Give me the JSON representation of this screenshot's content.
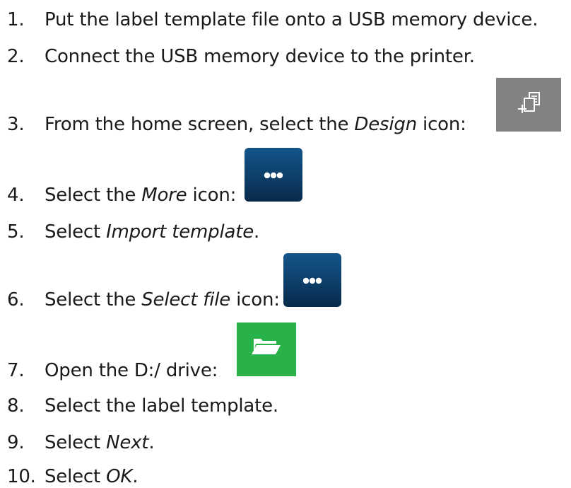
{
  "steps": [
    {
      "num": "1.",
      "text": "Put the label template file onto a USB memory device."
    },
    {
      "num": "2.",
      "text": "Connect the USB memory device to the printer."
    },
    {
      "num": "3.",
      "pre": "From the home screen, select the ",
      "em": "Design",
      "post": " icon:"
    },
    {
      "num": "4.",
      "pre": "Select the ",
      "em": "More",
      "post": " icon:"
    },
    {
      "num": "5.",
      "pre": "Select ",
      "em": "Import template",
      "post": "."
    },
    {
      "num": "6.",
      "pre": "Select the ",
      "em": "Select file",
      "post": " icon:"
    },
    {
      "num": "7.",
      "text": "Open the D:/ drive:"
    },
    {
      "num": "8.",
      "text": "Select the label template."
    },
    {
      "num": "9.",
      "pre": "Select ",
      "em": "Next",
      "post": "."
    },
    {
      "num": "10.",
      "pre": "Select ",
      "em": "OK",
      "post": "."
    }
  ],
  "icons": {
    "design": {
      "name": "design-icon",
      "color": "#828282"
    },
    "more": {
      "name": "more-icon",
      "color": "#0d3e68"
    },
    "select_file": {
      "name": "more-icon",
      "color": "#0d3e68"
    },
    "folder": {
      "name": "folder-icon",
      "color": "#2ab24a"
    }
  }
}
